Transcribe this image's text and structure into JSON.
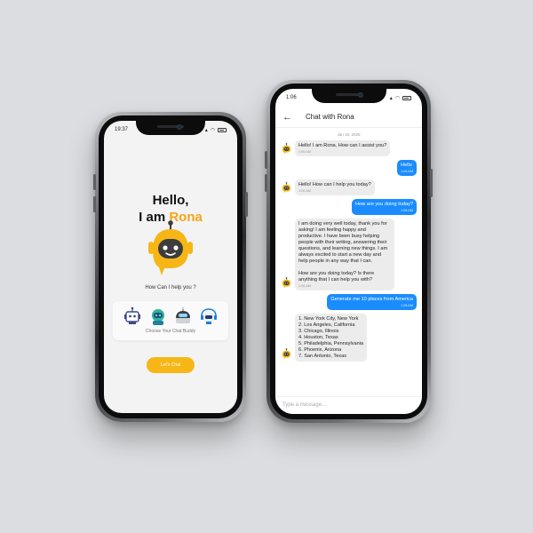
{
  "colors": {
    "accent_yellow": "#f6b716",
    "user_bubble": "#1a8cff",
    "bot_bubble": "#ececec",
    "robot_dark": "#3d3d3f"
  },
  "left_phone": {
    "status": {
      "time": "19:37",
      "icons": "signal, wifi, battery"
    },
    "greeting": {
      "line1": "Hello,",
      "line2_prefix": "I am",
      "name": "Rona"
    },
    "prompt": "How Can I help you ?",
    "buddies": [
      {
        "icon": "robot-square-icon"
      },
      {
        "icon": "robot-green-icon"
      },
      {
        "icon": "robot-dome-icon"
      },
      {
        "icon": "robot-headset-icon"
      }
    ],
    "buddy_caption": "Choose Your Chat Buddy",
    "cta": "Let's Chat"
  },
  "right_phone": {
    "status": {
      "time": "1:06"
    },
    "header": {
      "back_icon": "arrow-left-icon",
      "title": "Chat with Rona"
    },
    "date": "Jan 15, 2025",
    "messages": [
      {
        "from": "bot",
        "text": "Hello! I am Rona, How can I assist you?",
        "time": "1:06 AM"
      },
      {
        "from": "user",
        "text": "Hello",
        "time": "1:06 AM"
      },
      {
        "from": "bot",
        "text": "Hello! How can I help you today?",
        "time": "1:06 AM"
      },
      {
        "from": "user",
        "text": "How are you doing today?",
        "time": "1:06 AM"
      },
      {
        "from": "bot",
        "text": "I am doing very well today, thank you for asking! I am feeling happy and productive. I have been busy helping people with their writing, answering their questions, and learning new things. I am always excited to start a new day and help people in any way that I can.\n\nHow are you doing today? Is there anything that I can help you with?",
        "time": "1:06 AM"
      },
      {
        "from": "user",
        "text": "Generate me 10 places from America",
        "time": "1:06 AM"
      },
      {
        "from": "bot",
        "text": "1. New York City, New York\n2. Los Angeles, California\n3. Chicago, Illinois\n4. Houston, Texas\n5. Philadelphia, Pennsylvania\n6. Phoenix, Arizona\n7. San Antonio, Texas",
        "time": ""
      }
    ],
    "input_placeholder": "Type a message..."
  }
}
